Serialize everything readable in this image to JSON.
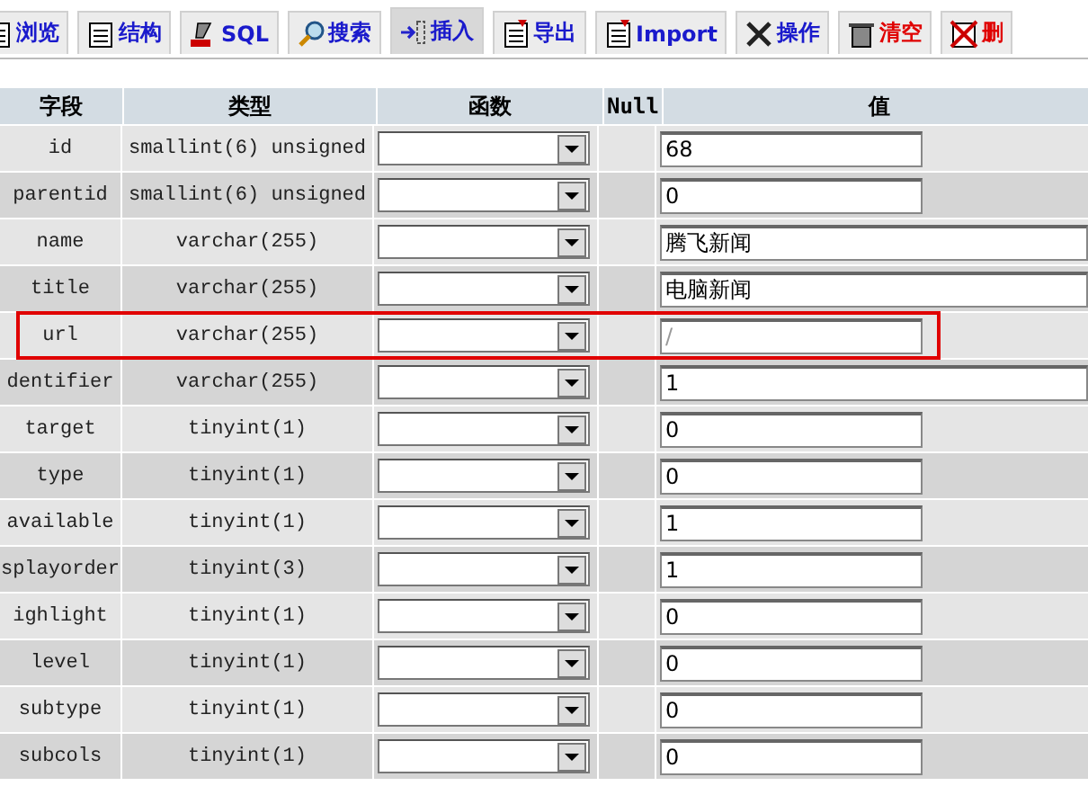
{
  "tabs": [
    {
      "label": "浏览",
      "selected": false,
      "danger": false
    },
    {
      "label": "结构",
      "selected": false,
      "danger": false
    },
    {
      "label": "SQL",
      "selected": false,
      "danger": false
    },
    {
      "label": "搜索",
      "selected": false,
      "danger": false
    },
    {
      "label": "插入",
      "selected": true,
      "danger": false
    },
    {
      "label": "导出",
      "selected": false,
      "danger": false
    },
    {
      "label": "Import",
      "selected": false,
      "danger": false
    },
    {
      "label": "操作",
      "selected": false,
      "danger": false
    },
    {
      "label": "清空",
      "selected": false,
      "danger": true
    },
    {
      "label": "删",
      "selected": false,
      "danger": true
    }
  ],
  "table": {
    "columns": [
      "字段",
      "类型",
      "函数",
      "Null",
      "值"
    ],
    "rows": [
      {
        "field": "id",
        "type": "smallint(6) unsigned",
        "value": "68",
        "wide": false,
        "highlighted": false
      },
      {
        "field": "parentid",
        "type": "smallint(6) unsigned",
        "value": "0",
        "wide": false,
        "highlighted": false
      },
      {
        "field": "name",
        "type": "varchar(255)",
        "value": "腾飞新闻",
        "wide": true,
        "highlighted": false
      },
      {
        "field": "title",
        "type": "varchar(255)",
        "value": "电脑新闻",
        "wide": true,
        "highlighted": false
      },
      {
        "field": "url",
        "type": "varchar(255)",
        "placeholder": "/",
        "wide": false,
        "highlighted": true
      },
      {
        "field": "dentifier",
        "type": "varchar(255)",
        "value": "1",
        "wide": true,
        "highlighted": false
      },
      {
        "field": "target",
        "type": "tinyint(1)",
        "value": "0",
        "wide": false,
        "highlighted": false
      },
      {
        "field": "type",
        "type": "tinyint(1)",
        "value": "0",
        "wide": false,
        "highlighted": false
      },
      {
        "field": "available",
        "type": "tinyint(1)",
        "value": "1",
        "wide": false,
        "highlighted": false
      },
      {
        "field": "splayorder",
        "type": "tinyint(3)",
        "value": "1",
        "wide": false,
        "highlighted": false
      },
      {
        "field": "ighlight",
        "type": "tinyint(1)",
        "value": "0",
        "wide": false,
        "highlighted": false
      },
      {
        "field": "level",
        "type": "tinyint(1)",
        "value": "0",
        "wide": false,
        "highlighted": false
      },
      {
        "field": "subtype",
        "type": "tinyint(1)",
        "value": "0",
        "wide": false,
        "highlighted": false
      },
      {
        "field": "subcols",
        "type": "tinyint(1)",
        "value": "0",
        "wide": false,
        "highlighted": false
      }
    ]
  }
}
